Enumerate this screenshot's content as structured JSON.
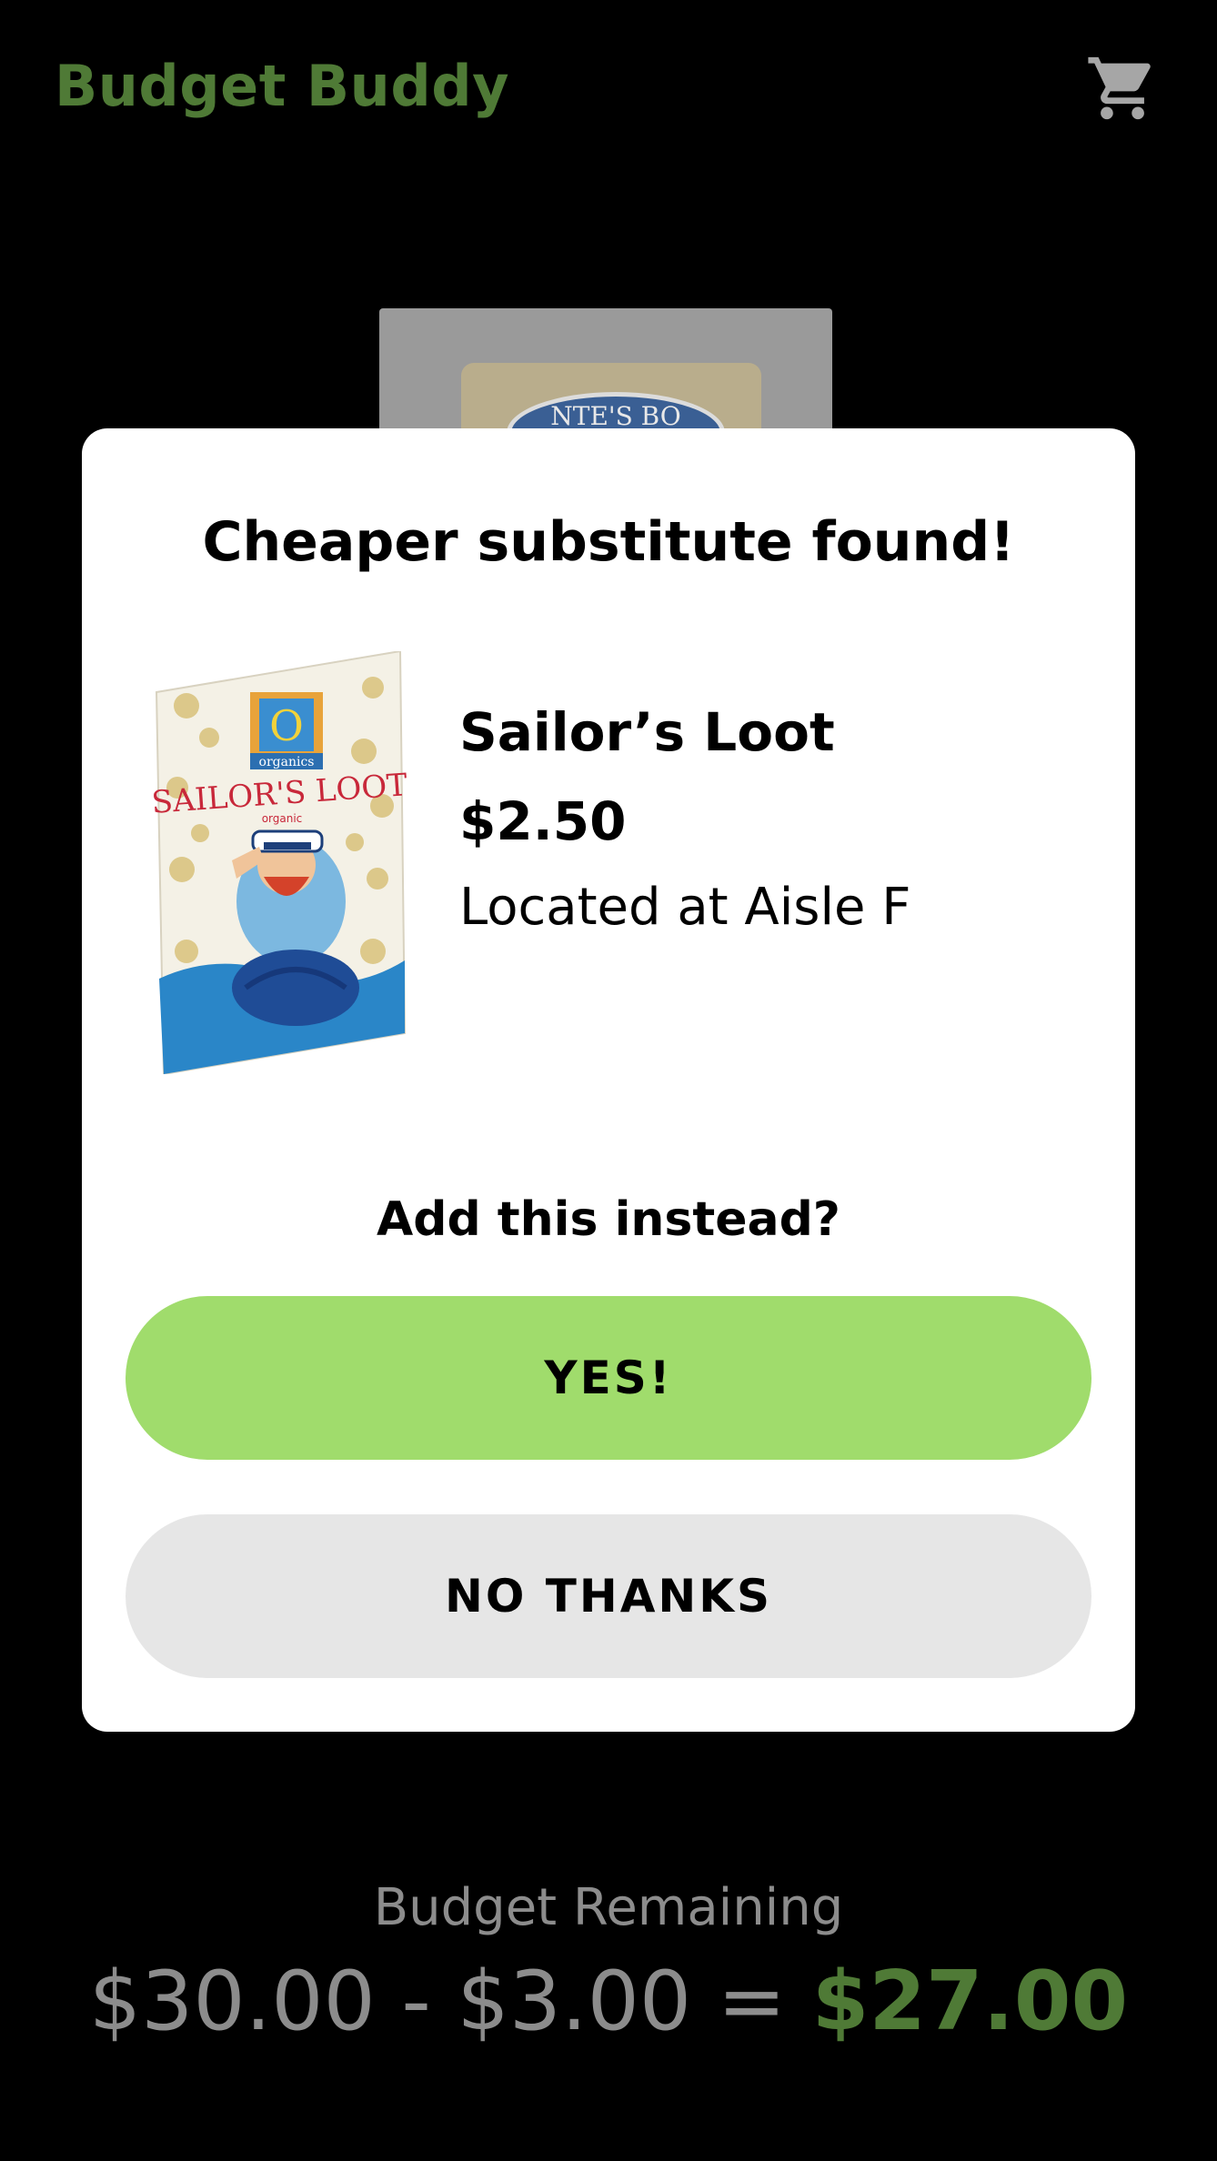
{
  "header": {
    "app_title": "Budget Buddy",
    "cart_icon": "shopping-cart-icon"
  },
  "background_product": {
    "bag_label": "NTE'S BO"
  },
  "modal": {
    "title": "Cheaper substitute found!",
    "product": {
      "name": "Sailor’s Loot",
      "price": "$2.50",
      "location": "Located at Aisle F",
      "bag_brand": "organics",
      "bag_logo_letter": "O",
      "bag_name": "SAILOR'S LOOT",
      "bag_subtitle": "organic"
    },
    "prompt": "Add this instead?",
    "yes_label": "YES!",
    "no_label": "NO THANKS"
  },
  "budget": {
    "label": "Budget Remaining",
    "total": "$30.00",
    "minus": "-",
    "spent": "$3.00",
    "equals": "=",
    "remaining": "$27.00"
  },
  "colors": {
    "brand_green": "#4f7a36",
    "yes_button": "#a0dc6c",
    "no_button": "#e6e6e6",
    "muted_text": "#8c8c8c"
  }
}
